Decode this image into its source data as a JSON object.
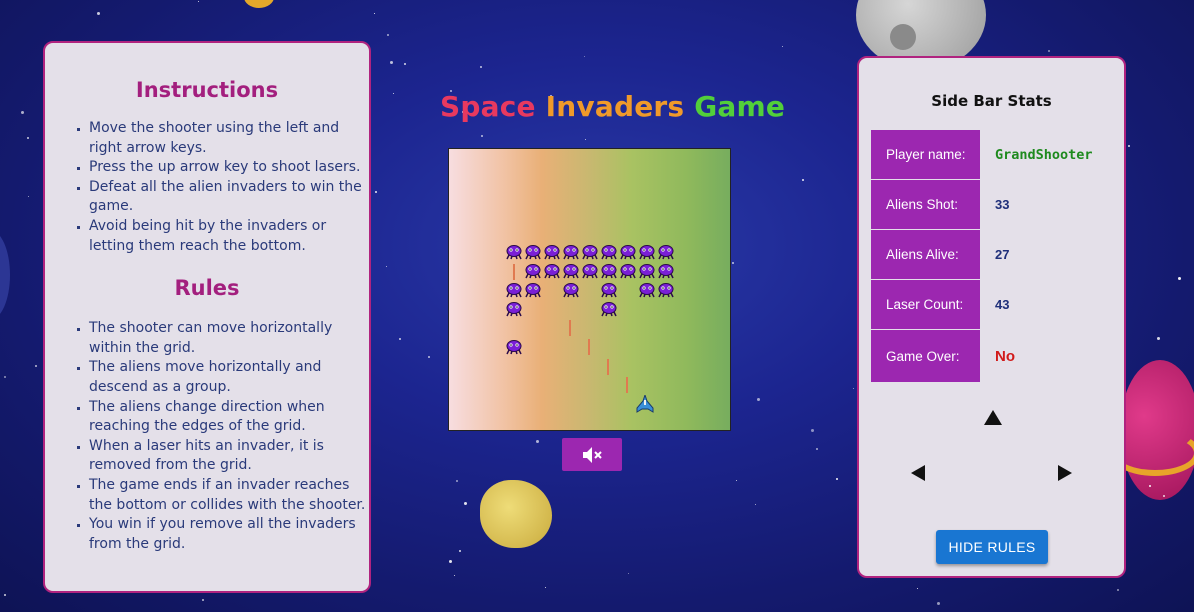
{
  "title": {
    "words": [
      {
        "text": "Space",
        "color": "#e8395f"
      },
      {
        "text": "Invaders",
        "color": "#f09a2a"
      },
      {
        "text": "Game",
        "color": "#52cf3a"
      }
    ]
  },
  "instructions": {
    "heading": "Instructions",
    "items": [
      "Move the shooter using the left and right arrow keys.",
      "Press the up arrow key to shoot lasers.",
      "Defeat all the alien invaders to win the game.",
      "Avoid being hit by the invaders or letting them reach the bottom."
    ]
  },
  "rules": {
    "heading": "Rules",
    "items": [
      "The shooter can move horizontally within the grid.",
      "The aliens move horizontally and descend as a group.",
      "The aliens change direction when reaching the edges of the grid.",
      "When a laser hits an invader, it is removed from the grid.",
      "The game ends if an invader reaches the bottom or collides with the shooter.",
      "You win if you remove all the invaders from the grid."
    ]
  },
  "stats": {
    "title": "Side Bar Stats",
    "rows": [
      {
        "label": "Player name:",
        "value": "GrandShooter",
        "value_color": "#1e8a1e"
      },
      {
        "label": "Aliens Shot:",
        "value": "33",
        "value_color": "#1f2f7a"
      },
      {
        "label": "Aliens Alive:",
        "value": "27",
        "value_color": "#1f2f7a"
      },
      {
        "label": "Laser Count:",
        "value": "43",
        "value_color": "#1f2f7a"
      },
      {
        "label": "Game Over:",
        "value": "No",
        "value_color": "#d11a1a"
      }
    ]
  },
  "controls": {
    "up_icon": "arrow-up-icon",
    "left_icon": "arrow-left-icon",
    "right_icon": "arrow-right-icon",
    "mute_icon": "volume-mute-icon",
    "hide_rules_label": "HIDE RULES"
  },
  "colors": {
    "accent_purple": "#9c27b0",
    "panel_border": "#b0237f",
    "heading_color": "#a31f7e",
    "button_blue": "#1976d2",
    "alien_color": "#7a1fd6"
  }
}
